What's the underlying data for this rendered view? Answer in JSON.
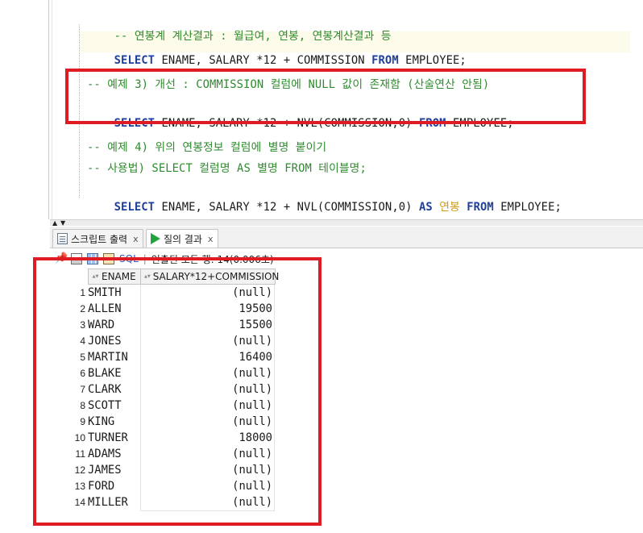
{
  "editor": {
    "cut_line": "-- 연봉계 계산결과 : 월급여, 연봉, 연봉계산결과 등",
    "line1": {
      "kw1": "SELECT",
      "mid": " ENAME, SALARY *12 + COMMISSION ",
      "kw2": "FROM",
      "tail": " EMPLOYEE;"
    },
    "comment3": "-- 예제 3) 개선 : COMMISSION 컬럼에 NULL 값이 존재함 (산술연산 안됨)",
    "line3": {
      "kw1": "SELECT",
      "mid": " ENAME, SALARY *12 + NVL(COMMISSION,0) ",
      "kw2": "FROM",
      "tail": " EMPLOYEE;"
    },
    "comment4a": "-- 예제 4) 위의 연봉정보 컬럼에 별명 붙이기",
    "comment4b": "-- 사용법) SELECT 컬럼명 AS 별명 FROM 테이블명;",
    "line4": {
      "kw1": "SELECT",
      "mid": " ENAME, SALARY *12 + NVL(COMMISSION,0) ",
      "kw2": "AS",
      "alias": " 연봉 ",
      "kw3": "FROM",
      "tail": " EMPLOYEE;"
    }
  },
  "tabs": [
    {
      "label": "스크립트 출력",
      "close": "x",
      "active": false
    },
    {
      "label": "질의 결과",
      "close": "x",
      "active": true
    }
  ],
  "toolbar": {
    "sql_label": "SQL",
    "separator": "|",
    "status": "인출된 모든 행: 14(0.006초)"
  },
  "results": {
    "columns": [
      "ENAME",
      "SALARY*12+COMMISSION"
    ],
    "rows": [
      {
        "n": "1",
        "ename": "SMITH",
        "value": "(null)"
      },
      {
        "n": "2",
        "ename": "ALLEN",
        "value": "19500"
      },
      {
        "n": "3",
        "ename": "WARD",
        "value": "15500"
      },
      {
        "n": "4",
        "ename": "JONES",
        "value": "(null)"
      },
      {
        "n": "5",
        "ename": "MARTIN",
        "value": "16400"
      },
      {
        "n": "6",
        "ename": "BLAKE",
        "value": "(null)"
      },
      {
        "n": "7",
        "ename": "CLARK",
        "value": "(null)"
      },
      {
        "n": "8",
        "ename": "SCOTT",
        "value": "(null)"
      },
      {
        "n": "9",
        "ename": "KING",
        "value": "(null)"
      },
      {
        "n": "10",
        "ename": "TURNER",
        "value": "18000"
      },
      {
        "n": "11",
        "ename": "ADAMS",
        "value": "(null)"
      },
      {
        "n": "12",
        "ename": "JAMES",
        "value": "(null)"
      },
      {
        "n": "13",
        "ename": "FORD",
        "value": "(null)"
      },
      {
        "n": "14",
        "ename": "MILLER",
        "value": "(null)"
      }
    ]
  },
  "colors": {
    "highlight_box": "#df1c24",
    "keyword": "#1f3f9a",
    "comment": "#2e8b2e",
    "alias": "#d09a18"
  }
}
